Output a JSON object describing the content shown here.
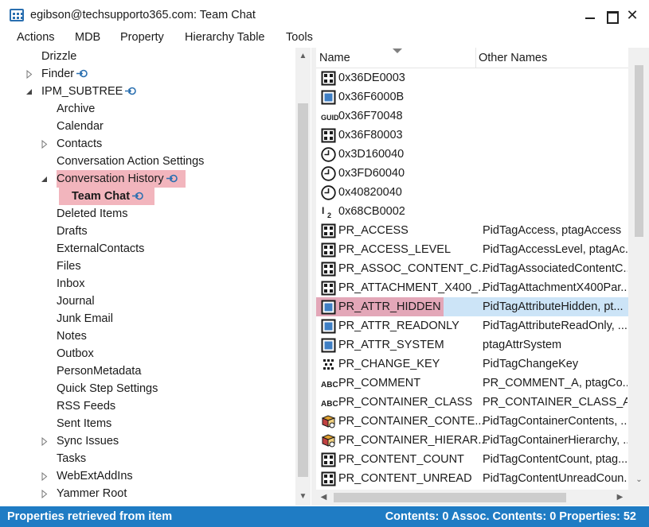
{
  "window": {
    "title": "egibson@techsupporto365.com: Team Chat",
    "close_glyph": "✕"
  },
  "menu": [
    "Actions",
    "MDB",
    "Property",
    "Hierarchy Table",
    "Tools"
  ],
  "tree": {
    "items": [
      {
        "label": "Drizzle",
        "level": 0,
        "expander": "none",
        "link": false
      },
      {
        "label": "Finder",
        "level": 0,
        "expander": "collapsed",
        "link": true
      },
      {
        "label": "IPM_SUBTREE",
        "level": 0,
        "expander": "expanded",
        "link": true
      },
      {
        "label": "Archive",
        "level": 1,
        "expander": "none",
        "link": false
      },
      {
        "label": "Calendar",
        "level": 1,
        "expander": "none",
        "link": false
      },
      {
        "label": "Contacts",
        "level": 1,
        "expander": "collapsed",
        "link": false
      },
      {
        "label": "Conversation Action Settings",
        "level": 1,
        "expander": "none",
        "link": false
      },
      {
        "label": "Conversation History",
        "level": 1,
        "expander": "expanded",
        "link": true,
        "highlight": "parent"
      },
      {
        "label": "Team Chat",
        "level": 2,
        "expander": "none",
        "link": true,
        "highlight": "selected"
      },
      {
        "label": "Deleted Items",
        "level": 1,
        "expander": "none",
        "link": false
      },
      {
        "label": "Drafts",
        "level": 1,
        "expander": "none",
        "link": false
      },
      {
        "label": "ExternalContacts",
        "level": 1,
        "expander": "none",
        "link": false
      },
      {
        "label": "Files",
        "level": 1,
        "expander": "none",
        "link": false
      },
      {
        "label": "Inbox",
        "level": 1,
        "expander": "none",
        "link": false
      },
      {
        "label": "Journal",
        "level": 1,
        "expander": "none",
        "link": false
      },
      {
        "label": "Junk Email",
        "level": 1,
        "expander": "none",
        "link": false
      },
      {
        "label": "Notes",
        "level": 1,
        "expander": "none",
        "link": false
      },
      {
        "label": "Outbox",
        "level": 1,
        "expander": "none",
        "link": false
      },
      {
        "label": "PersonMetadata",
        "level": 1,
        "expander": "none",
        "link": false
      },
      {
        "label": "Quick Step Settings",
        "level": 1,
        "expander": "none",
        "link": false
      },
      {
        "label": "RSS Feeds",
        "level": 1,
        "expander": "none",
        "link": false
      },
      {
        "label": "Sent Items",
        "level": 1,
        "expander": "none",
        "link": false
      },
      {
        "label": "Sync Issues",
        "level": 1,
        "expander": "collapsed",
        "link": false
      },
      {
        "label": "Tasks",
        "level": 1,
        "expander": "none",
        "link": false
      },
      {
        "label": "WebExtAddIns",
        "level": 1,
        "expander": "collapsed",
        "link": false
      },
      {
        "label": "Yammer Root",
        "level": 1,
        "expander": "collapsed",
        "link": false
      }
    ]
  },
  "list": {
    "columns": [
      "Name",
      "Other Names"
    ],
    "rows": [
      {
        "name": "0x36DE0003",
        "other": "",
        "icon": "integer-icon"
      },
      {
        "name": "0x36F6000B",
        "other": "",
        "icon": "boolean-icon"
      },
      {
        "name": "0x36F70048",
        "other": "",
        "icon": "guid-icon"
      },
      {
        "name": "0x36F80003",
        "other": "",
        "icon": "integer-icon"
      },
      {
        "name": "0x3D160040",
        "other": "",
        "icon": "clock-icon"
      },
      {
        "name": "0x3FD60040",
        "other": "",
        "icon": "clock-icon"
      },
      {
        "name": "0x40820040",
        "other": "",
        "icon": "clock-icon"
      },
      {
        "name": "0x68CB0002",
        "other": "",
        "icon": "short-integer-icon"
      },
      {
        "name": "PR_ACCESS",
        "other": "PidTagAccess, ptagAccess",
        "icon": "integer-icon"
      },
      {
        "name": "PR_ACCESS_LEVEL",
        "other": "PidTagAccessLevel, ptagAc...",
        "icon": "integer-icon"
      },
      {
        "name": "PR_ASSOC_CONTENT_C...",
        "other": "PidTagAssociatedContentC...",
        "icon": "integer-icon"
      },
      {
        "name": "PR_ATTACHMENT_X400_...",
        "other": "PidTagAttachmentX400Par...",
        "icon": "integer-icon"
      },
      {
        "name": "PR_ATTR_HIDDEN",
        "other": "PidTagAttributeHidden, pt...",
        "icon": "boolean-icon",
        "selected": true
      },
      {
        "name": "PR_ATTR_READONLY",
        "other": "PidTagAttributeReadOnly, ...",
        "icon": "boolean-icon"
      },
      {
        "name": "PR_ATTR_SYSTEM",
        "other": "ptagAttrSystem",
        "icon": "boolean-icon"
      },
      {
        "name": "PR_CHANGE_KEY",
        "other": "PidTagChangeKey",
        "icon": "binary-icon"
      },
      {
        "name": "PR_COMMENT",
        "other": "PR_COMMENT_A, ptagCo...",
        "icon": "string-icon"
      },
      {
        "name": "PR_CONTAINER_CLASS",
        "other": "PR_CONTAINER_CLASS_A, ...",
        "icon": "string-icon"
      },
      {
        "name": "PR_CONTAINER_CONTE...",
        "other": "PidTagContainerContents, ...",
        "icon": "object-icon"
      },
      {
        "name": "PR_CONTAINER_HIERAR...",
        "other": "PidTagContainerHierarchy, ...",
        "icon": "object-icon"
      },
      {
        "name": "PR_CONTENT_COUNT",
        "other": "PidTagContentCount, ptag...",
        "icon": "integer-icon"
      },
      {
        "name": "PR_CONTENT_UNREAD",
        "other": "PidTagContentUnreadCoun...",
        "icon": "integer-icon"
      }
    ]
  },
  "status": {
    "left": "Properties retrieved from item",
    "right": "Contents: 0 Assoc. Contents: 0  Properties: 52"
  },
  "colors": {
    "status_bar": "#1f7cc4",
    "tree_highlight": "#f2b5bd",
    "row_selected": "#cce4f7"
  }
}
